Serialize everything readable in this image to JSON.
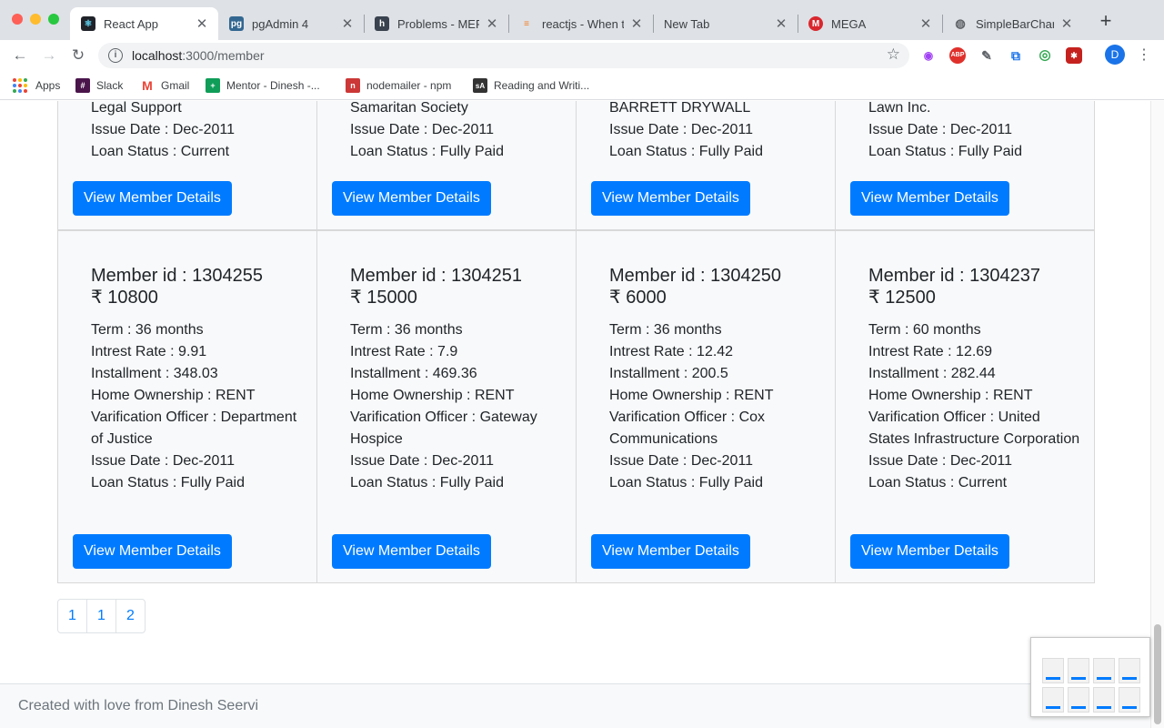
{
  "browser": {
    "tabs": [
      {
        "label": "React App",
        "icon": "react-icon",
        "active": true
      },
      {
        "label": "pgAdmin 4",
        "icon": "pgadmin-icon"
      },
      {
        "label": "Problems - MERN",
        "icon": "hackerrank-icon"
      },
      {
        "label": "reactjs - When to",
        "icon": "stackoverflow-icon"
      },
      {
        "label": "New Tab",
        "icon": ""
      },
      {
        "label": "MEGA",
        "icon": "mega-icon"
      },
      {
        "label": "SimpleBarChart",
        "icon": "globe-icon"
      }
    ],
    "url_host": "localhost",
    "url_path": ":3000/member",
    "profile_initial": "D",
    "bookmarks": [
      {
        "label": "Apps",
        "icon": "apps-grid-icon"
      },
      {
        "label": "Slack",
        "icon": "slack-icon"
      },
      {
        "label": "Gmail",
        "icon": "gmail-icon"
      },
      {
        "label": "Mentor - Dinesh -...",
        "icon": "sheets-icon"
      },
      {
        "label": "nodemailer - npm",
        "icon": "npm-icon"
      },
      {
        "label": "Reading and Writi...",
        "icon": "sa-icon"
      }
    ]
  },
  "top_cards": [
    {
      "lines": [
        "Legal Support",
        "Issue Date : Dec-2011",
        "Loan Status : Current"
      ],
      "button": "View Member Details"
    },
    {
      "lines": [
        "Samaritan Society",
        "Issue Date : Dec-2011",
        "Loan Status : Fully Paid"
      ],
      "button": "View Member Details"
    },
    {
      "lines": [
        "BARRETT DRYWALL",
        "Issue Date : Dec-2011",
        "Loan Status : Fully Paid"
      ],
      "button": "View Member Details"
    },
    {
      "lines": [
        "Lawn Inc.",
        "Issue Date : Dec-2011",
        "Loan Status : Fully Paid"
      ],
      "button": "View Member Details"
    }
  ],
  "cards": [
    {
      "title": "Member id : 1304255",
      "amount": "₹ 10800",
      "term": "Term : 36 months",
      "rate": "Intrest Rate : 9.91",
      "installment": "Installment : 348.03",
      "ownership": "Home Ownership : RENT",
      "officer": "Varification Officer : Department of Justice",
      "issue": "Issue Date : Dec-2011",
      "status": "Loan Status : Fully Paid",
      "button": "View Member Details"
    },
    {
      "title": "Member id : 1304251",
      "amount": "₹ 15000",
      "term": "Term : 36 months",
      "rate": "Intrest Rate : 7.9",
      "installment": "Installment : 469.36",
      "ownership": "Home Ownership : RENT",
      "officer": "Varification Officer : Gateway Hospice",
      "issue": "Issue Date : Dec-2011",
      "status": "Loan Status : Fully Paid",
      "button": "View Member Details"
    },
    {
      "title": "Member id : 1304250",
      "amount": "₹ 6000",
      "term": "Term : 36 months",
      "rate": "Intrest Rate : 12.42",
      "installment": "Installment : 200.5",
      "ownership": "Home Ownership : RENT",
      "officer": "Varification Officer : Cox Communications",
      "issue": "Issue Date : Dec-2011",
      "status": "Loan Status : Fully Paid",
      "button": "View Member Details"
    },
    {
      "title": "Member id : 1304237",
      "amount": "₹ 12500",
      "term": "Term : 60 months",
      "rate": "Intrest Rate : 12.69",
      "installment": "Installment : 282.44",
      "ownership": "Home Ownership : RENT",
      "officer": "Varification Officer : United States Infrastructure Corporation",
      "issue": "Issue Date : Dec-2011",
      "status": "Loan Status : Current",
      "button": "View Member Details"
    }
  ],
  "pagination": [
    "1",
    "1",
    "2"
  ],
  "footer": "Created with love from Dinesh Seervi",
  "colors": {
    "primary": "#007bff",
    "card_bg": "#f8f9fa"
  }
}
